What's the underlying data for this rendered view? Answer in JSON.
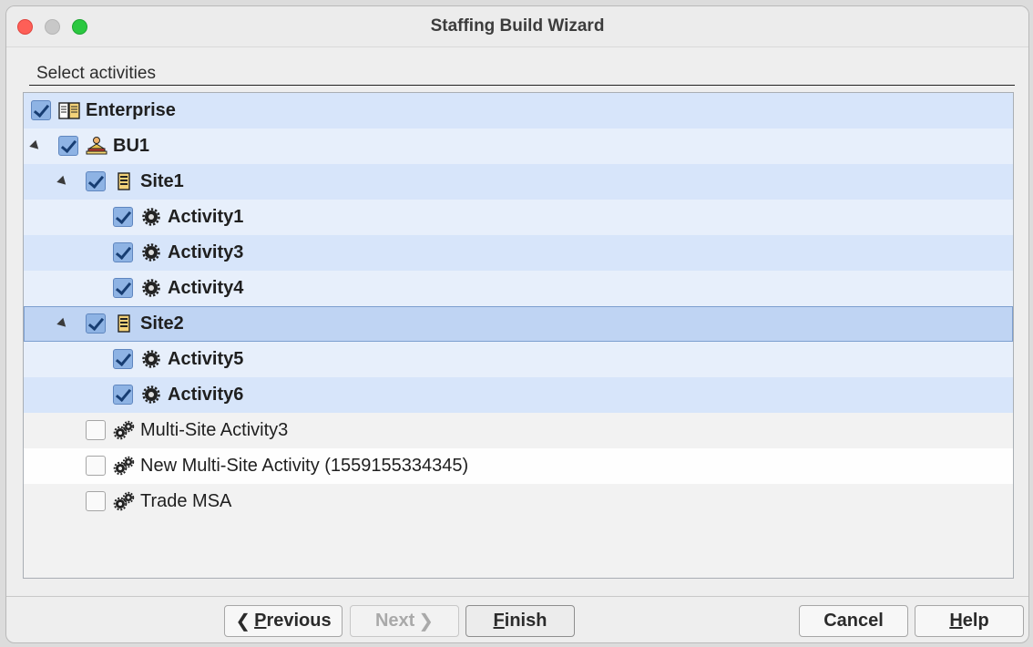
{
  "window": {
    "title": "Staffing Build Wizard"
  },
  "section": {
    "label": "Select activities"
  },
  "tree": {
    "enterprise": "Enterprise",
    "bu1": "BU1",
    "site1": "Site1",
    "activity1": "Activity1",
    "activity3": "Activity3",
    "activity4": "Activity4",
    "site2": "Site2",
    "activity5": "Activity5",
    "activity6": "Activity6",
    "multi_site_activity3": "Multi-Site Activity3",
    "new_multi_site_activity": "New Multi-Site Activity (1559155334345)",
    "trade_msa": "Trade MSA"
  },
  "buttons": {
    "previous_mnemonic": "P",
    "previous_rest": "revious",
    "next": "Next",
    "finish_mnemonic": "F",
    "finish_rest": "inish",
    "cancel": "Cancel",
    "help_mnemonic": "H",
    "help_rest": "elp"
  }
}
